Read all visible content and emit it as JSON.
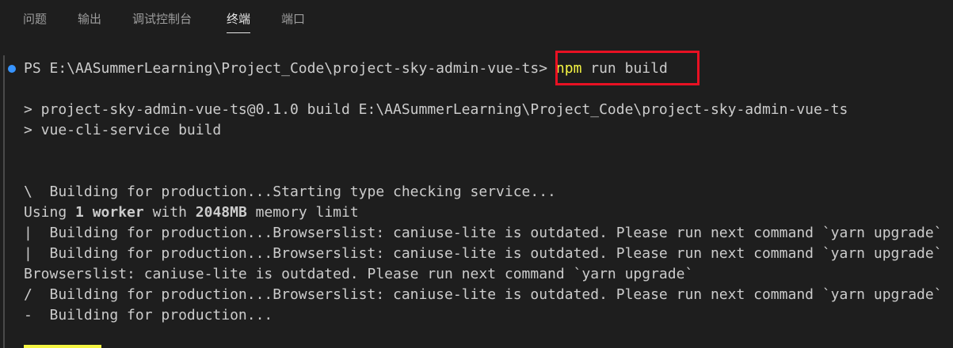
{
  "panel_tabs": [
    {
      "label": "问题",
      "active": false
    },
    {
      "label": "输出",
      "active": false
    },
    {
      "label": "调试控制台",
      "active": false
    },
    {
      "label": "终端",
      "active": true
    },
    {
      "label": "端口",
      "active": false
    }
  ],
  "terminal": {
    "prompt": "PS E:\\AASummerLearning\\Project_Code\\project-sky-admin-vue-ts>",
    "command_name": "npm",
    "command_args": " run build",
    "script_line_1": "> project-sky-admin-vue-ts@0.1.0 build E:\\AASummerLearning\\Project_Code\\project-sky-admin-vue-ts",
    "script_line_2": "> vue-cli-service build",
    "progress_1": "\\  Building for production...Starting type checking service...",
    "using_prefix": "Using ",
    "worker_count": "1 worker",
    "with_text": " with ",
    "memory_value": "2048MB",
    "memory_suffix": " memory limit",
    "progress_2": "|  Building for production...Browserslist: caniuse-lite is outdated. Please run next command `yarn upgrade`",
    "progress_3": "|  Building for production...Browserslist: caniuse-lite is outdated. Please run next command `yarn upgrade`",
    "browserslist_warning": "Browserslist: caniuse-lite is outdated. Please run next command `yarn upgrade`",
    "progress_4": "/  Building for production...Browserslist: caniuse-lite is outdated. Please run next command `yarn upgrade`",
    "progress_5": "-  Building for production..."
  },
  "colors": {
    "background": "#1e1e1e",
    "text": "#cccccc",
    "command_highlight": "#f5f543",
    "annotation_box": "#e81123",
    "decoration_dot": "#3794ff"
  },
  "icons": {
    "command_decoration": "circle-dot-icon"
  }
}
